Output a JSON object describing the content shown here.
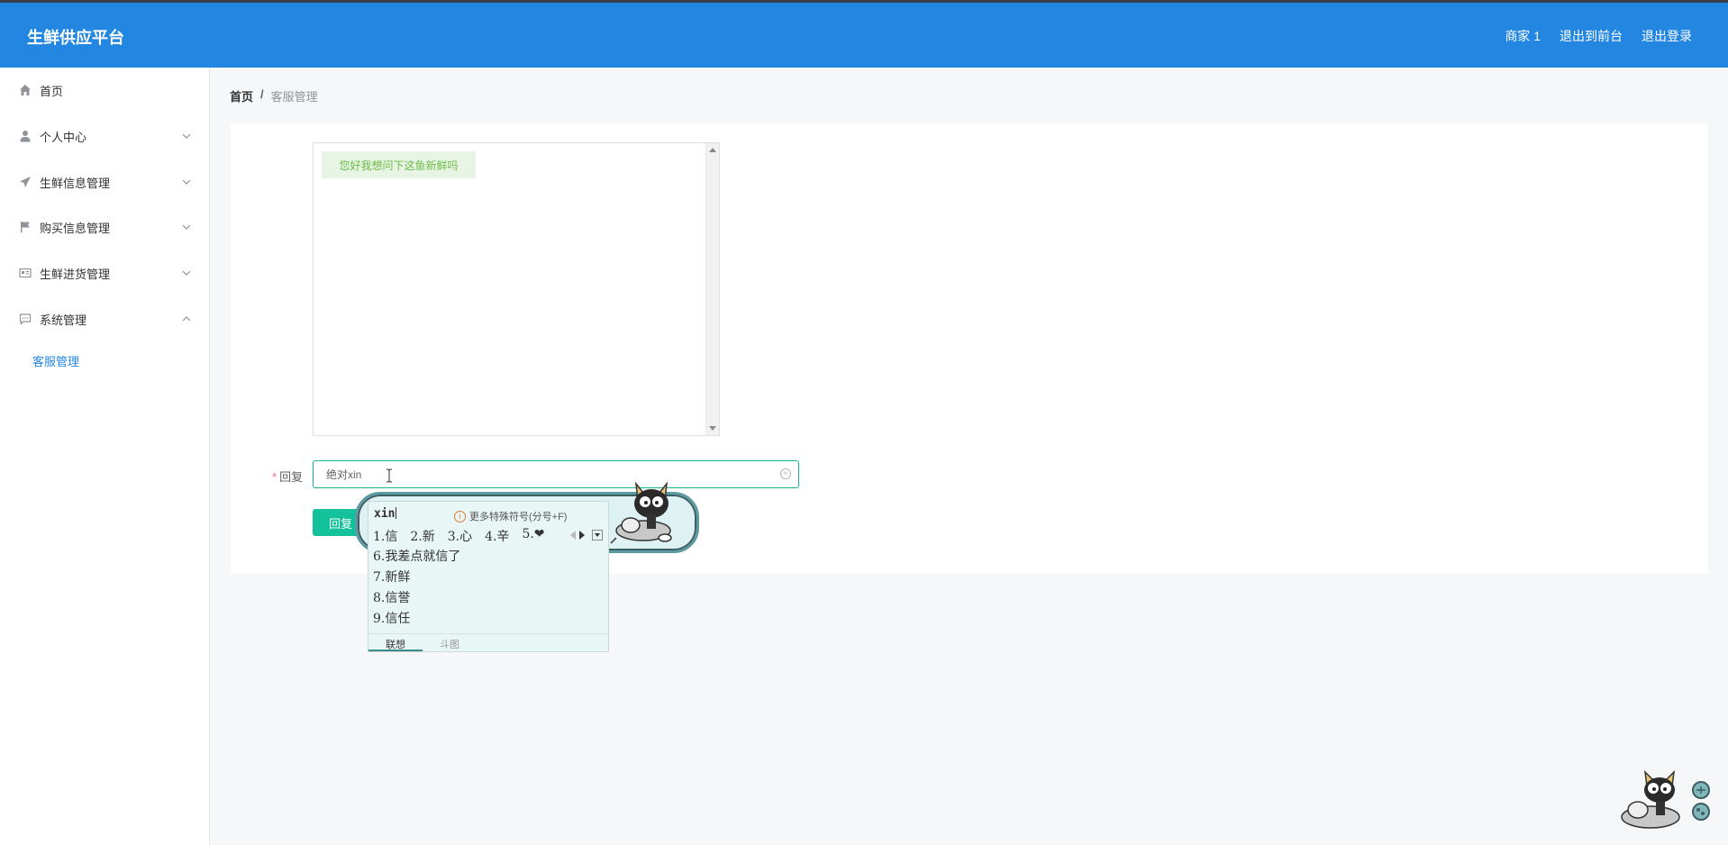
{
  "header": {
    "title": "生鲜供应平台",
    "links": [
      "商家 1",
      "退出到前台",
      "退出登录"
    ]
  },
  "sidebar": {
    "items": [
      {
        "label": "首页",
        "icon": "home-icon"
      },
      {
        "label": "个人中心",
        "icon": "user-icon"
      },
      {
        "label": "生鲜信息管理",
        "icon": "send-icon"
      },
      {
        "label": "购买信息管理",
        "icon": "flag-icon"
      },
      {
        "label": "生鲜进货管理",
        "icon": "postcard-icon"
      },
      {
        "label": "系统管理",
        "icon": "chat-icon"
      }
    ],
    "active_sub": "客服管理"
  },
  "breadcrumb": {
    "home": "首页",
    "separator": "/",
    "current": "客服管理"
  },
  "chat": {
    "messages": [
      "您好我想问下这鱼新鲜吗"
    ]
  },
  "form": {
    "reply_label": "回复",
    "required_mark": "*",
    "reply_value": "绝对xin",
    "submit_label": "回复"
  },
  "ime": {
    "pinyin": "xin",
    "hint": "更多特殊符号(分号+F)",
    "row1": [
      "1.信",
      "2.新",
      "3.心",
      "4.辛",
      "5.❤"
    ],
    "list": [
      "6.我差点就信了",
      "7.新鲜",
      "8.信誉",
      "9.信任"
    ],
    "tabs": [
      "联想",
      "斗图"
    ]
  },
  "colors": {
    "header_bg": "#2387e1",
    "accent": "#2387e1",
    "button": "#13c29b"
  }
}
